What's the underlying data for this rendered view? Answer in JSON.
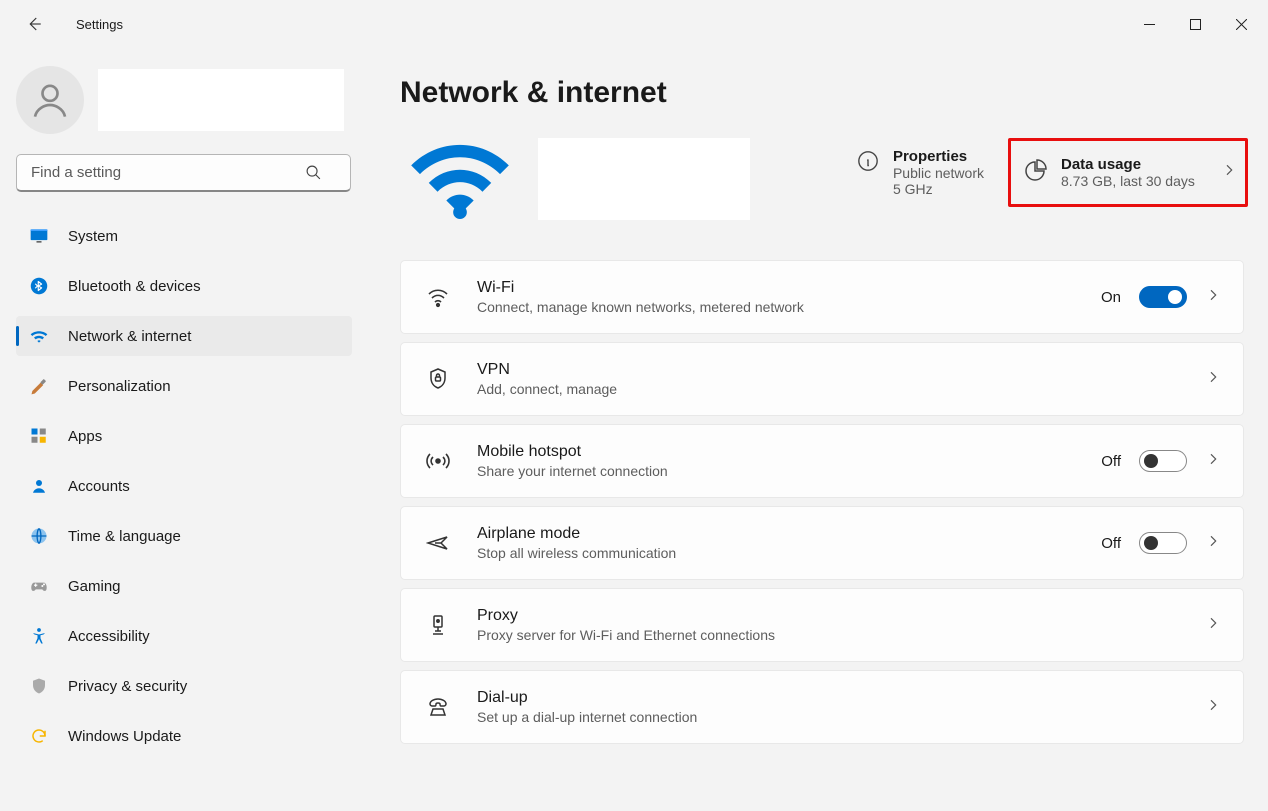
{
  "app": {
    "title": "Settings"
  },
  "search": {
    "placeholder": "Find a setting"
  },
  "sidebar": {
    "items": [
      {
        "label": "System"
      },
      {
        "label": "Bluetooth & devices"
      },
      {
        "label": "Network & internet"
      },
      {
        "label": "Personalization"
      },
      {
        "label": "Apps"
      },
      {
        "label": "Accounts"
      },
      {
        "label": "Time & language"
      },
      {
        "label": "Gaming"
      },
      {
        "label": "Accessibility"
      },
      {
        "label": "Privacy & security"
      },
      {
        "label": "Windows Update"
      }
    ]
  },
  "page": {
    "title": "Network & internet",
    "properties": {
      "label": "Properties",
      "line1": "Public network",
      "line2": "5 GHz"
    },
    "dataUsage": {
      "label": "Data usage",
      "sub": "8.73 GB, last 30 days"
    }
  },
  "cards": {
    "wifi": {
      "title": "Wi-Fi",
      "sub": "Connect, manage known networks, metered network",
      "state": "On"
    },
    "vpn": {
      "title": "VPN",
      "sub": "Add, connect, manage"
    },
    "hotspot": {
      "title": "Mobile hotspot",
      "sub": "Share your internet connection",
      "state": "Off"
    },
    "airplane": {
      "title": "Airplane mode",
      "sub": "Stop all wireless communication",
      "state": "Off"
    },
    "proxy": {
      "title": "Proxy",
      "sub": "Proxy server for Wi-Fi and Ethernet connections"
    },
    "dialup": {
      "title": "Dial-up",
      "sub": "Set up a dial-up internet connection"
    }
  }
}
